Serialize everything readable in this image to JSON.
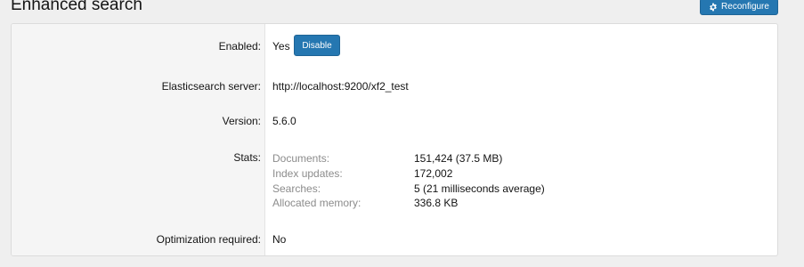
{
  "page": {
    "title": "Enhanced search",
    "reconfigure_label": "Reconfigure"
  },
  "rows": {
    "enabled": {
      "label": "Enabled:",
      "value": "Yes",
      "button": "Disable"
    },
    "server": {
      "label": "Elasticsearch server:",
      "value": "http://localhost:9200/xf2_test"
    },
    "version": {
      "label": "Version:",
      "value": "5.6.0"
    },
    "stats": {
      "label": "Stats:",
      "items": [
        {
          "name": "Documents:",
          "value": "151,424 (37.5 MB)"
        },
        {
          "name": "Index updates:",
          "value": "172,002"
        },
        {
          "name": "Searches:",
          "value": "5 (21 milliseconds average)"
        },
        {
          "name": "Allocated memory:",
          "value": "336.8 KB"
        }
      ]
    },
    "optimization": {
      "label": "Optimization required:",
      "value": "No"
    }
  },
  "colors": {
    "accent": "#2577b1",
    "page_bg": "#efefef",
    "label_col_bg": "#f5f5f5",
    "muted_text": "#8c8c8c"
  },
  "icons": {
    "reconfigure": "gear-icon"
  }
}
